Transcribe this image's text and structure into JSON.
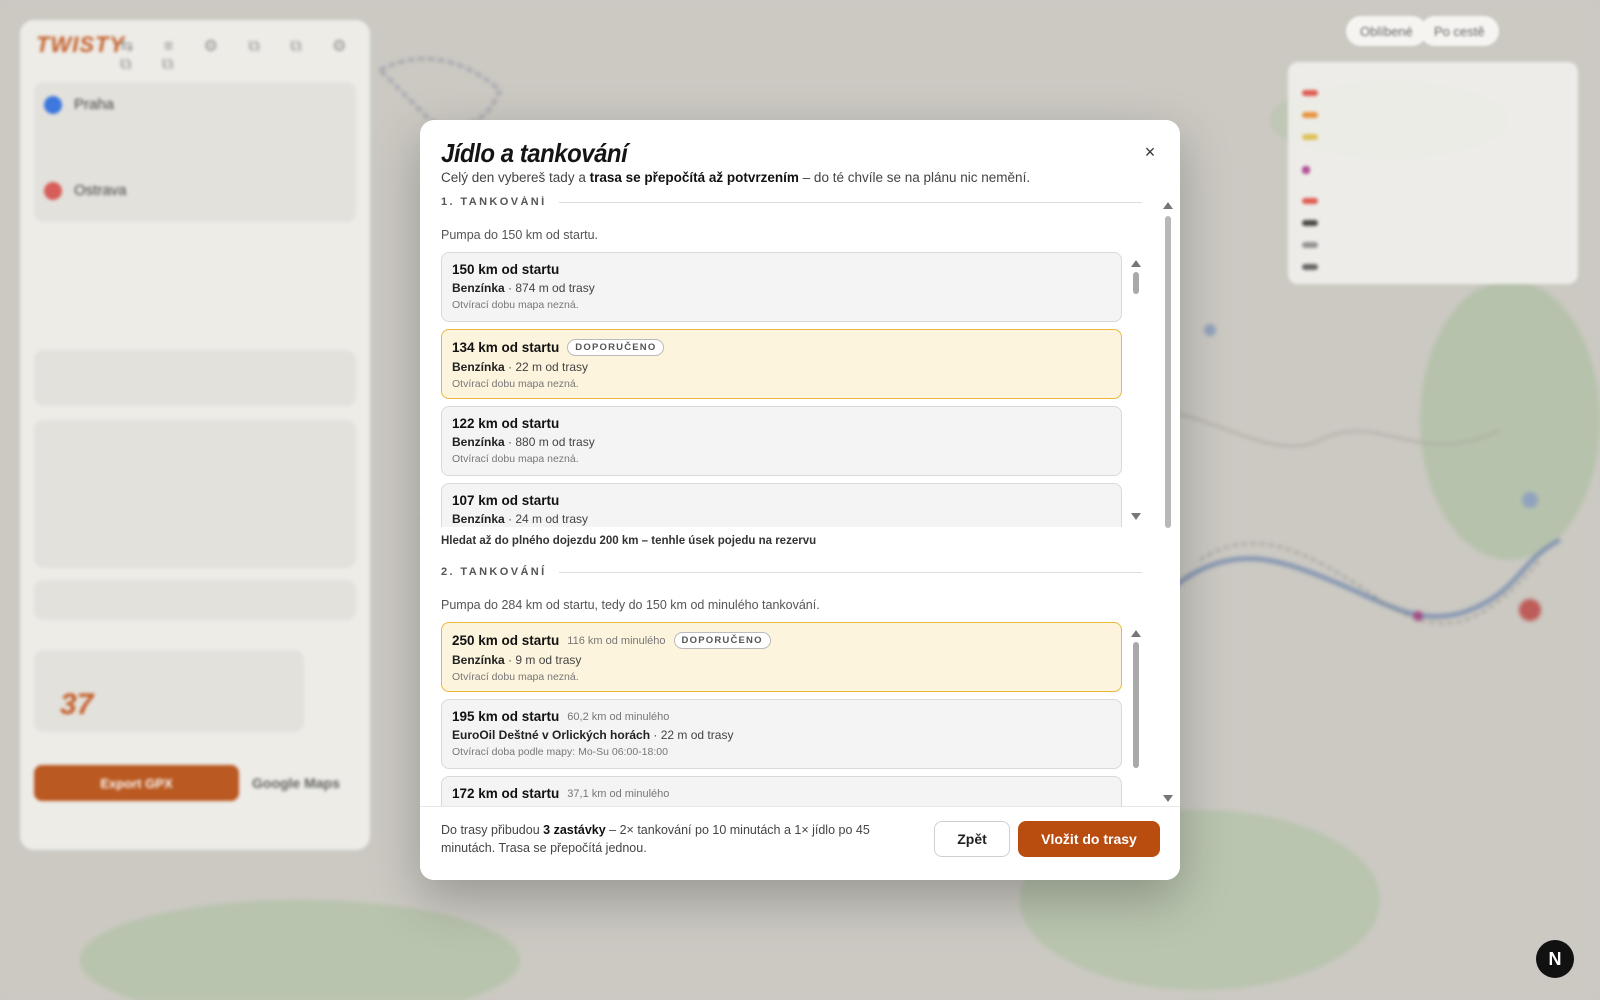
{
  "app": {
    "logo": "TWISTY"
  },
  "sidebar": {
    "start": "Praha",
    "end": "Ostrava",
    "export_label": "Export GPX",
    "gmaps_label": "Google Maps",
    "score": "37"
  },
  "topbar": {
    "pill1": "Oblíbené",
    "pill2": "Po cestě"
  },
  "modal": {
    "title": "Jídlo a tankování",
    "subtitle_pre": "Celý den vybereš tady a ",
    "subtitle_bold": "trasa se přepočítá až potvrzením",
    "subtitle_post": " – do té chvíle se na plánu nic nemění.",
    "close_label": "×",
    "sections": [
      {
        "heading": "1. TANKOVÁNÍ",
        "desc": "Pumpa do 150 km od startu.",
        "footer": "Hledat až do plného dojezdu 200 km – tenhle úsek pojedu na rezervu",
        "items": [
          {
            "km": "150 km od startu",
            "since": "",
            "badge": "",
            "type": "Benzínka",
            "dist": " · 874 m od trasy",
            "hours": "Otvírací dobu mapa nezná.",
            "recommended": false
          },
          {
            "km": "134 km od startu",
            "since": "",
            "badge": "DOPORUČENO",
            "type": "Benzínka",
            "dist": " · 22 m od trasy",
            "hours": "Otvírací dobu mapa nezná.",
            "recommended": true
          },
          {
            "km": "122 km od startu",
            "since": "",
            "badge": "",
            "type": "Benzínka",
            "dist": " · 880 m od trasy",
            "hours": "Otvírací dobu mapa nezná.",
            "recommended": false
          },
          {
            "km": "107 km od startu",
            "since": "",
            "badge": "",
            "type": "Benzínka",
            "dist": " · 24 m od trasy",
            "hours": "",
            "recommended": false
          }
        ]
      },
      {
        "heading": "2. TANKOVÁNÍ",
        "desc": "Pumpa do 284 km od startu, tedy do 150 km od minulého tankování.",
        "footer": "",
        "items": [
          {
            "km": "250 km od startu",
            "since": "116 km od minulého",
            "badge": "DOPORUČENO",
            "type": "Benzínka",
            "dist": " · 9 m od trasy",
            "hours": "Otvírací dobu mapa nezná.",
            "recommended": true
          },
          {
            "km": "195 km od startu",
            "since": "60,2 km od minulého",
            "badge": "",
            "type": "EuroOil Deštné v Orlických horách",
            "dist": " · 22 m od trasy",
            "hours": "Otvírací doba podle mapy: Mo-Su 06:00-18:00",
            "recommended": false
          },
          {
            "km": "172 km od startu",
            "since": "37,1 km od minulého",
            "badge": "",
            "type": "",
            "dist": "",
            "hours": "",
            "recommended": false
          }
        ]
      }
    ],
    "footer": {
      "note_pre": "Do trasy přibudou ",
      "note_bold": "3 zastávky",
      "note_post": " – 2× tankování po 10 minutách a 1× jídlo po 45 minutách. Trasa se přepočítá jednou.",
      "back_label": "Zpět",
      "insert_label": "Vložit do trasy"
    }
  },
  "colors": {
    "accent": "#b94d10",
    "recommended_bg": "#fdf4dd",
    "recommended_border": "#e7b83b"
  }
}
